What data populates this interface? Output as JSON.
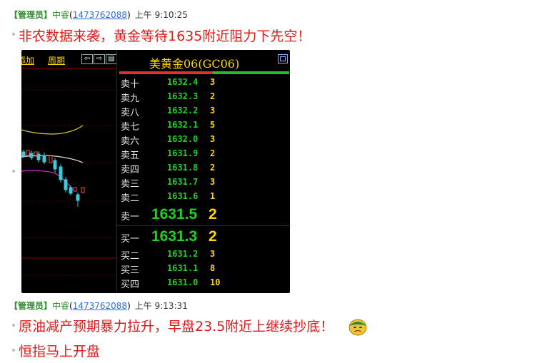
{
  "messages": [
    {
      "role": "【管理员】",
      "name": "中睿",
      "uid": "1473762088",
      "time": "上午 9:10:25",
      "lines": [
        "非农数据来袭，黄金等待1635附近阻力下先空！"
      ]
    },
    {
      "role": "【管理员】",
      "name": "中睿",
      "uid": "1473762088",
      "time": "上午 9:13:31",
      "lines": [
        "原油减产预期暴力拉升，早盘23.5附近上继续抄底！",
        "恒指马上开盘"
      ]
    }
  ],
  "screenshot": {
    "toolbar": {
      "add_label": "添加",
      "period_label": "周期"
    },
    "title": "美黄金06(GC06)",
    "bar": {
      "sell_fraction": 0.55
    },
    "asks": [
      {
        "label": "卖十",
        "price": "1632.4",
        "vol": "3"
      },
      {
        "label": "卖九",
        "price": "1632.3",
        "vol": "2"
      },
      {
        "label": "卖八",
        "price": "1632.2",
        "vol": "3"
      },
      {
        "label": "卖七",
        "price": "1632.1",
        "vol": "5"
      },
      {
        "label": "卖六",
        "price": "1632.0",
        "vol": "3"
      },
      {
        "label": "卖五",
        "price": "1631.9",
        "vol": "2"
      },
      {
        "label": "卖四",
        "price": "1631.8",
        "vol": "2"
      },
      {
        "label": "卖三",
        "price": "1631.7",
        "vol": "3"
      },
      {
        "label": "卖二",
        "price": "1631.6",
        "vol": "1"
      }
    ],
    "ask1": {
      "label": "卖一",
      "price": "1631.5",
      "vol": "2"
    },
    "bid1": {
      "label": "买一",
      "price": "1631.3",
      "vol": "2"
    },
    "bids": [
      {
        "label": "买二",
        "price": "1631.2",
        "vol": "3"
      },
      {
        "label": "买三",
        "price": "1631.1",
        "vol": "8"
      },
      {
        "label": "买四",
        "price": "1631.0",
        "vol": "10"
      }
    ]
  },
  "icons": {
    "emoji": "sick-face-emoji",
    "nav": [
      "arrow-left-icon",
      "arrow-right-icon",
      "menu-icon"
    ]
  },
  "colors": {
    "message_red": "#e01818",
    "admin_green": "#2e8b2e",
    "uid_blue": "#2e6bd9",
    "price_green": "#22d022",
    "vol_yellow": "#ffd700"
  }
}
